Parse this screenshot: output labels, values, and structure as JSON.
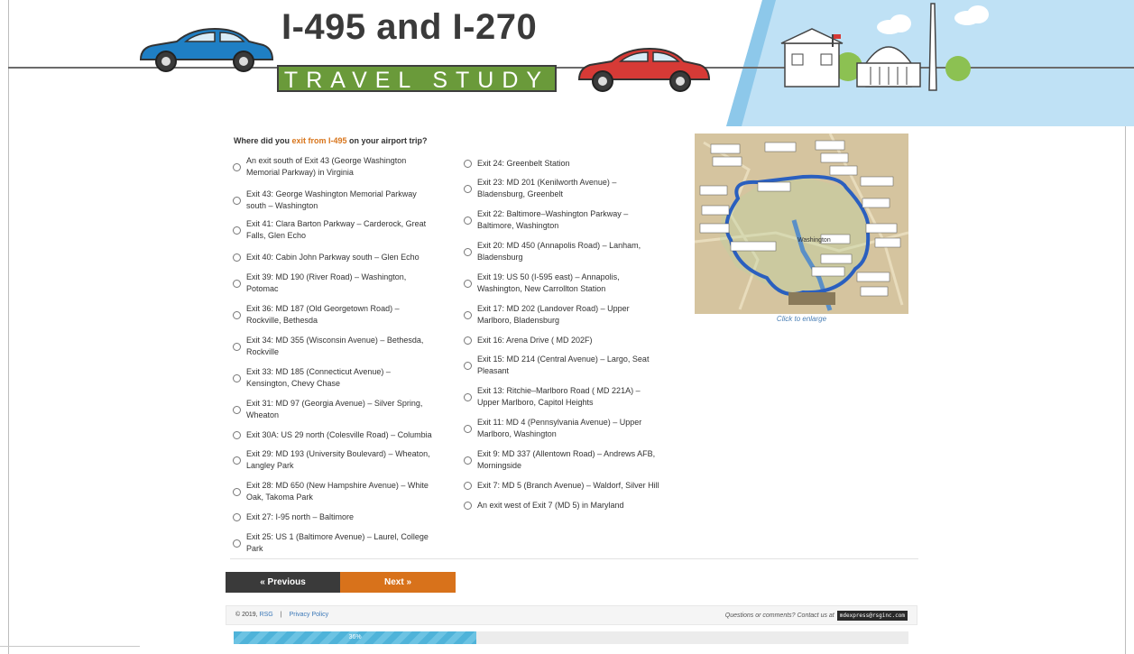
{
  "header": {
    "title": "I-495 and I-270",
    "subtitle": "TRAVEL STUDY"
  },
  "question": {
    "prefix": "Where did you ",
    "highlight": "exit from I-495",
    "suffix": " on your airport trip?"
  },
  "options_left": [
    [
      "An exit south of Exit 43 (George Washington",
      "Memorial Parkway) in Virginia"
    ],
    [
      "Exit 43: George Washington Memorial Parkway",
      "south – Washington"
    ],
    [
      "Exit 41: Clara Barton Parkway – Carderock, Great",
      "Falls, Glen Echo"
    ],
    [
      "Exit 40: Cabin John Parkway south – Glen Echo"
    ],
    [
      "Exit 39: MD 190 (River Road) – Washington,",
      "Potomac"
    ],
    [
      "Exit 36: MD 187 (Old Georgetown Road) –",
      "Rockville, Bethesda"
    ],
    [
      "Exit 34: MD 355 (Wisconsin Avenue) – Bethesda,",
      "Rockville"
    ],
    [
      "Exit 33: MD 185 (Connecticut Avenue) –",
      "Kensington, Chevy Chase"
    ],
    [
      "Exit 31: MD 97 (Georgia Avenue) – Silver Spring,",
      "Wheaton"
    ],
    [
      "Exit 30A: US 29 north (Colesville Road) – Columbia"
    ],
    [
      "Exit 29: MD 193 (University Boulevard) – Wheaton,",
      "Langley Park"
    ],
    [
      "Exit 28: MD 650 (New Hampshire Avenue) – White",
      "Oak, Takoma Park"
    ],
    [
      "Exit 27: I-95 north – Baltimore"
    ],
    [
      "Exit 25: US 1 (Baltimore Avenue) – Laurel, College",
      "Park"
    ]
  ],
  "options_right": [
    [
      "Exit 24: Greenbelt Station"
    ],
    [
      "Exit 23: MD 201 (Kenilworth Avenue) –",
      "Bladensburg, Greenbelt"
    ],
    [
      "Exit 22: Baltimore–Washington Parkway –",
      "Baltimore, Washington"
    ],
    [
      "Exit 20: MD 450 (Annapolis Road) – Lanham,",
      "Bladensburg"
    ],
    [
      "Exit 19: US 50 (I-595 east) – Annapolis,",
      "Washington, New Carrollton Station"
    ],
    [
      "Exit 17: MD 202 (Landover Road) – Upper",
      "Marlboro, Bladensburg"
    ],
    [
      "Exit 16: Arena Drive ( MD 202F)"
    ],
    [
      "Exit 15: MD 214 (Central Avenue) – Largo, Seat",
      "Pleasant"
    ],
    [
      "Exit 13: Ritchie–Marlboro Road ( MD 221A) –",
      "Upper Marlboro, Capitol Heights"
    ],
    [
      "Exit 11: MD 4 (Pennsylvania Avenue) – Upper",
      "Marlboro, Washington"
    ],
    [
      "Exit 9: MD 337 (Allentown Road) – Andrews AFB,",
      "Morningside"
    ],
    [
      "Exit 7: MD 5 (Branch Avenue) – Waldorf, Silver Hill"
    ],
    [
      "An exit west of Exit 7 (MD 5) in Maryland"
    ]
  ],
  "map": {
    "caption": "Click to enlarge",
    "label": "Washington"
  },
  "nav": {
    "previous": "« Previous",
    "next": "Next »"
  },
  "footer": {
    "copyright": "© 2019, ",
    "rsg": "RSG",
    "separator": "|",
    "privacy": "Privacy Policy",
    "contact": "Questions or comments? Contact us at",
    "email": "mdexpress@rsginc.com"
  },
  "progress": {
    "label": "36%",
    "value": 36
  },
  "colors": {
    "accent_orange": "#d8721b",
    "nav_dark": "#3a3a3a",
    "logo_green": "#6a9a3a",
    "progress_blue": "#4fb3d9",
    "link_blue": "#3b78b8"
  }
}
